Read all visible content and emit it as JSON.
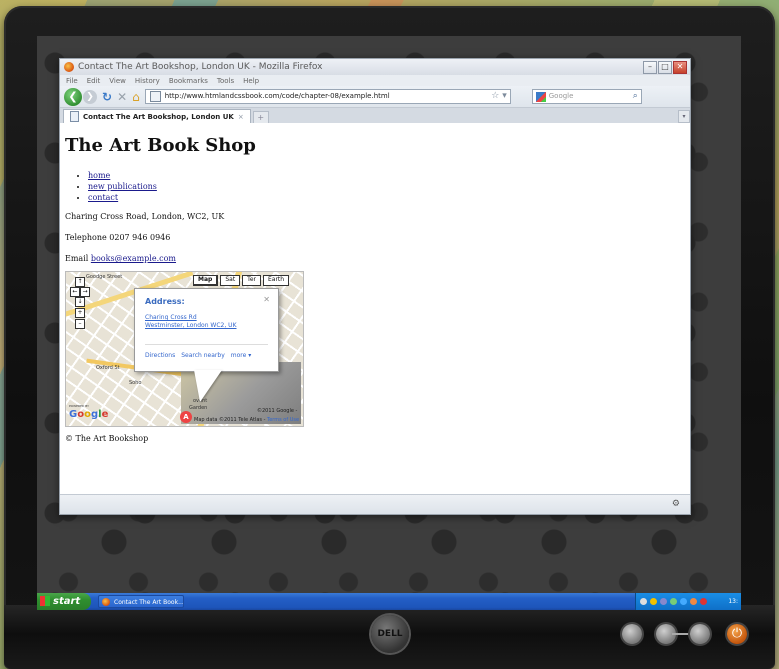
{
  "browser": {
    "window_title": "Contact The Art Bookshop, London UK - Mozilla Firefox",
    "menu": [
      "File",
      "Edit",
      "View",
      "History",
      "Bookmarks",
      "Tools",
      "Help"
    ],
    "url": "http://www.htmlandcssbook.com/code/chapter-08/example.html",
    "search_placeholder": "Google",
    "tab_label": "Contact The Art Bookshop, London UK",
    "new_tab": "+"
  },
  "page": {
    "title": "The Art Book Shop",
    "nav": [
      "home",
      "new publications",
      "contact"
    ],
    "address": "Charing Cross Road, London, WC2, UK",
    "telephone": "Telephone 0207 946 0946",
    "email_prefix": "Email ",
    "email": "books@example.com",
    "footer": "© The Art Bookshop"
  },
  "map": {
    "types": [
      "Map",
      "Sat",
      "Ter",
      "Earth"
    ],
    "labels": {
      "goodge": "Goodge Street",
      "soho": "Soho",
      "oxford": "Oxford St",
      "garden": "Garden",
      "covent": "ovent"
    },
    "infowindow": {
      "title": "Address:",
      "line1": "Charing Cross Rd",
      "line2": "Westminster, London WC2, UK",
      "actions": [
        "Directions",
        "Search nearby",
        "more ▾"
      ]
    },
    "pin": "A",
    "copyright": "©2011 Google -",
    "mapdata": "Map data ©2011 Tele Atlas - ",
    "terms": "Terms of Use",
    "powered": "POWERED BY",
    "logo": [
      "G",
      "o",
      "o",
      "g",
      "l",
      "e"
    ]
  },
  "taskbar": {
    "start": "start",
    "task": "Contact The Art Book...",
    "clock": "13:"
  },
  "monitor": {
    "brand": "DELL"
  }
}
